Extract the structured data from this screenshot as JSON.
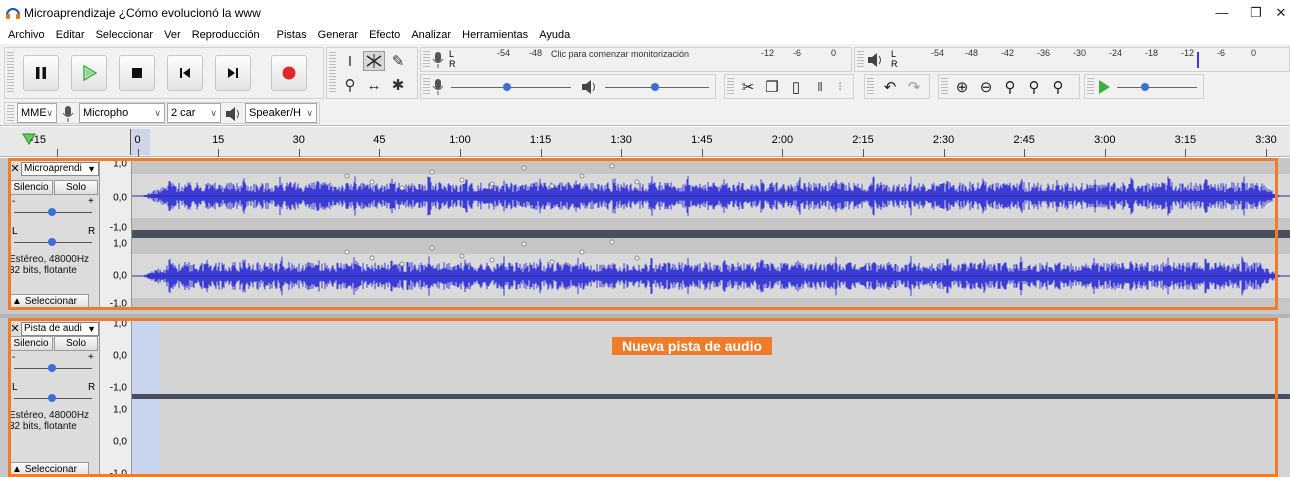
{
  "window": {
    "title": "Microaprendizaje ¿Cómo evolucionó la www",
    "minimize_glyph": "—",
    "restore_glyph": "❐",
    "close_glyph": "✕"
  },
  "menu": [
    "Archivo",
    "Editar",
    "Seleccionar",
    "Ver",
    "Reproducción",
    "Pistas",
    "Generar",
    "Efecto",
    "Analizar",
    "Herramientas",
    "Ayuda"
  ],
  "meters": {
    "record_scale": [
      "-54",
      "-48",
      "-12",
      "-6",
      "0"
    ],
    "record_prompt": "Clic para comenzar monitorización",
    "play_scale": [
      "-54",
      "-48",
      "-42",
      "-36",
      "-30",
      "-24",
      "-18",
      "-12",
      "-6",
      "0"
    ],
    "lr_L": "L",
    "lr_R": "R"
  },
  "device": {
    "host": "MME",
    "input": "Micropho",
    "channels": "2 car",
    "output": "Speaker/H"
  },
  "timeline": {
    "labels": [
      "-15",
      "0",
      "15",
      "30",
      "45",
      "1:00",
      "1:15",
      "1:30",
      "1:45",
      "2:00",
      "2:15",
      "2:30",
      "2:45",
      "3:00",
      "3:15",
      "3:30"
    ]
  },
  "tracks": [
    {
      "name": "Microaprendi",
      "mute_label": "Silencio",
      "solo_label": "Solo",
      "gain_minus": "-",
      "gain_plus": "+",
      "pan_left": "L",
      "pan_right": "R",
      "info_line1": "Estéreo, 48000Hz",
      "info_line2": "32 bits, flotante",
      "select_label": "Seleccionar",
      "ruler": [
        "1,0",
        "0,0",
        "-1,0",
        "1,0",
        "0,0",
        "-1,0"
      ]
    },
    {
      "name": "Pista de audi",
      "mute_label": "Silencio",
      "solo_label": "Solo",
      "gain_minus": "-",
      "gain_plus": "+",
      "pan_left": "L",
      "pan_right": "R",
      "info_line1": "Estéreo, 48000Hz",
      "info_line2": "32 bits, flotante",
      "select_label": "Seleccionar",
      "ruler": [
        "1,0",
        "0,0",
        "-1,0",
        "1,0",
        "0,0",
        "-1,0"
      ]
    }
  ],
  "annotation": {
    "text": "Nueva pista de audio"
  },
  "colors": {
    "accent_orange": "#f07c2b",
    "waveform_blue": "#3b3bd6",
    "play_green": "#3fae3f",
    "record_red": "#e02a2a"
  }
}
